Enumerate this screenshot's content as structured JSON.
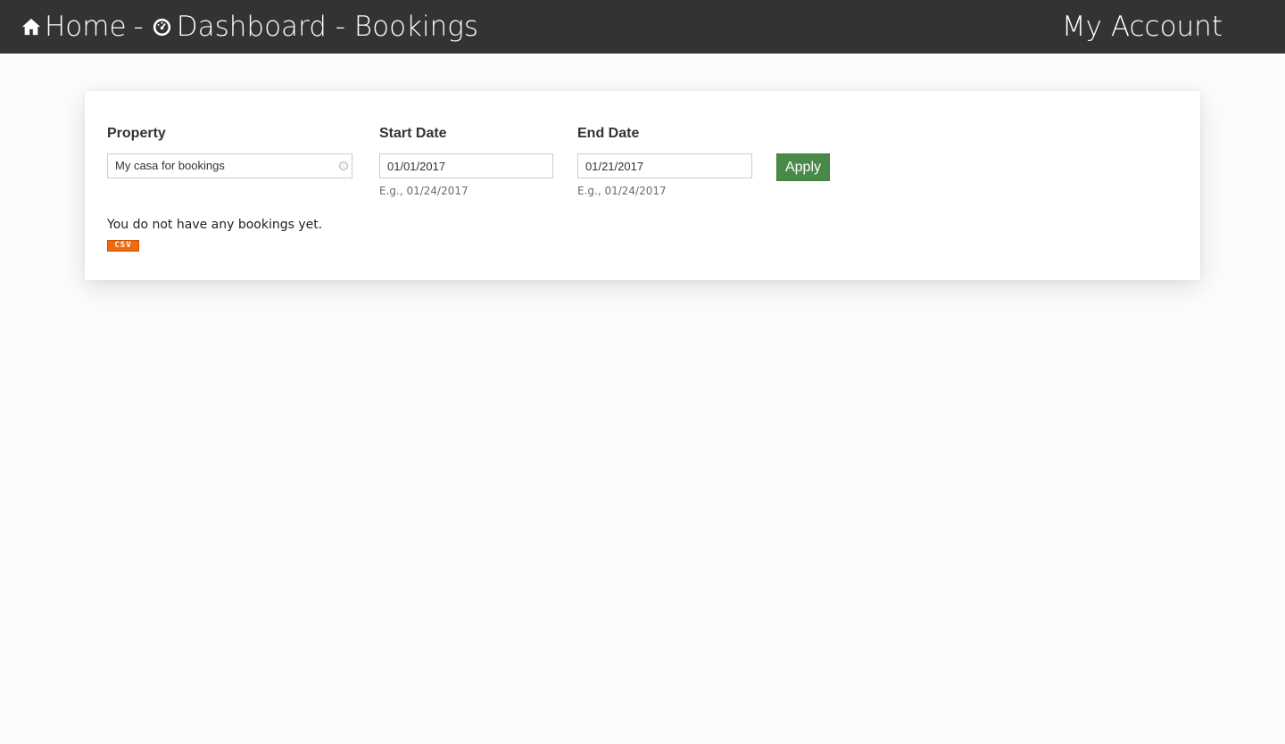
{
  "nav": {
    "home_label": "Home",
    "separator": "-",
    "dashboard_label": "Dashboard - Bookings",
    "account_label": "My Account"
  },
  "filters": {
    "property": {
      "label": "Property",
      "selected": "My casa for bookings"
    },
    "start_date": {
      "label": "Start Date",
      "value": "01/01/2017",
      "hint": "E.g., 01/24/2017"
    },
    "end_date": {
      "label": "End Date",
      "value": "01/21/2017",
      "hint": "E.g., 01/24/2017"
    },
    "apply_label": "Apply"
  },
  "results": {
    "empty_message": "You do not have any bookings yet.",
    "csv_label": "CSV"
  },
  "colors": {
    "topbar": "#333333",
    "apply_button": "#4a8a49",
    "csv_badge": "#f06a10"
  }
}
